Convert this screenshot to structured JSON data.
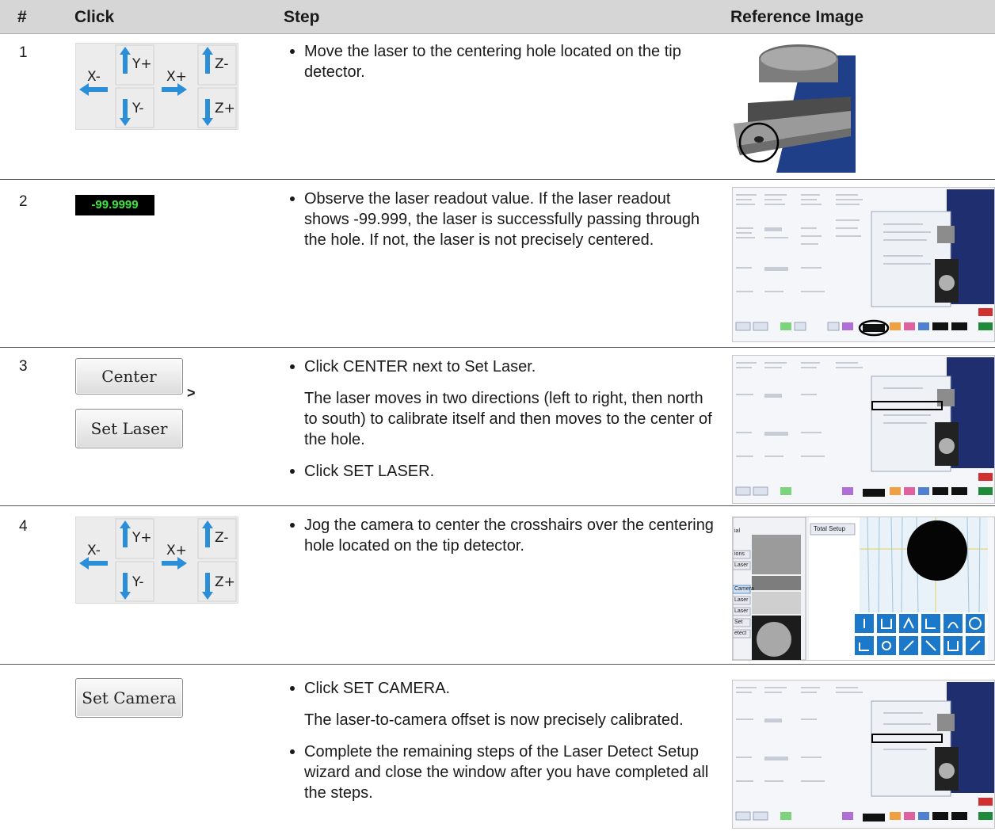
{
  "header": {
    "col_num": "#",
    "col_click": "Click",
    "col_step": "Step",
    "col_ref": "Reference Image"
  },
  "jog_pad": {
    "x_minus": "X-",
    "x_plus": "X+",
    "y_plus": "Y+",
    "y_minus": "Y-",
    "z_minus": "Z-",
    "z_plus": "Z+",
    "arrow_color": "#2a8fd8"
  },
  "rows": [
    {
      "num": "1",
      "bullets": [
        "Move the laser to the centering hole located on the tip detector."
      ]
    },
    {
      "num": "2",
      "readout": "-99.9999",
      "bullets": [
        "Observe the laser readout value. If the laser readout shows -99.999, the laser is successfully passing through the hole. If not, the laser is not precisely centered."
      ]
    },
    {
      "num": "3",
      "center_label": "Center",
      "gt": ">",
      "set_laser_label": "Set Laser",
      "bullet1": "Click CENTER next to Set Laser.",
      "para": "The laser moves in two directions (left to right, then north to south) to calibrate itself and then moves to the center of the hole.",
      "bullet2": "Click SET LASER."
    },
    {
      "num": "4",
      "bullets": [
        "Jog the camera to center the crosshairs over the centering hole located on the tip detector."
      ],
      "ref_labels": [
        "ial",
        "ions",
        "Laser",
        "Camera",
        "Laser",
        "Laser",
        "Set",
        "etect",
        "Total Setup"
      ]
    },
    {
      "num": "",
      "set_camera_label": "Set Camera",
      "bullet1": "Click SET CAMERA.",
      "para": "The laser-to-camera offset is now precisely calibrated.",
      "bullet2": "Complete the remaining steps of the Laser Detect Setup wizard and close the window after you have completed all the steps."
    }
  ]
}
